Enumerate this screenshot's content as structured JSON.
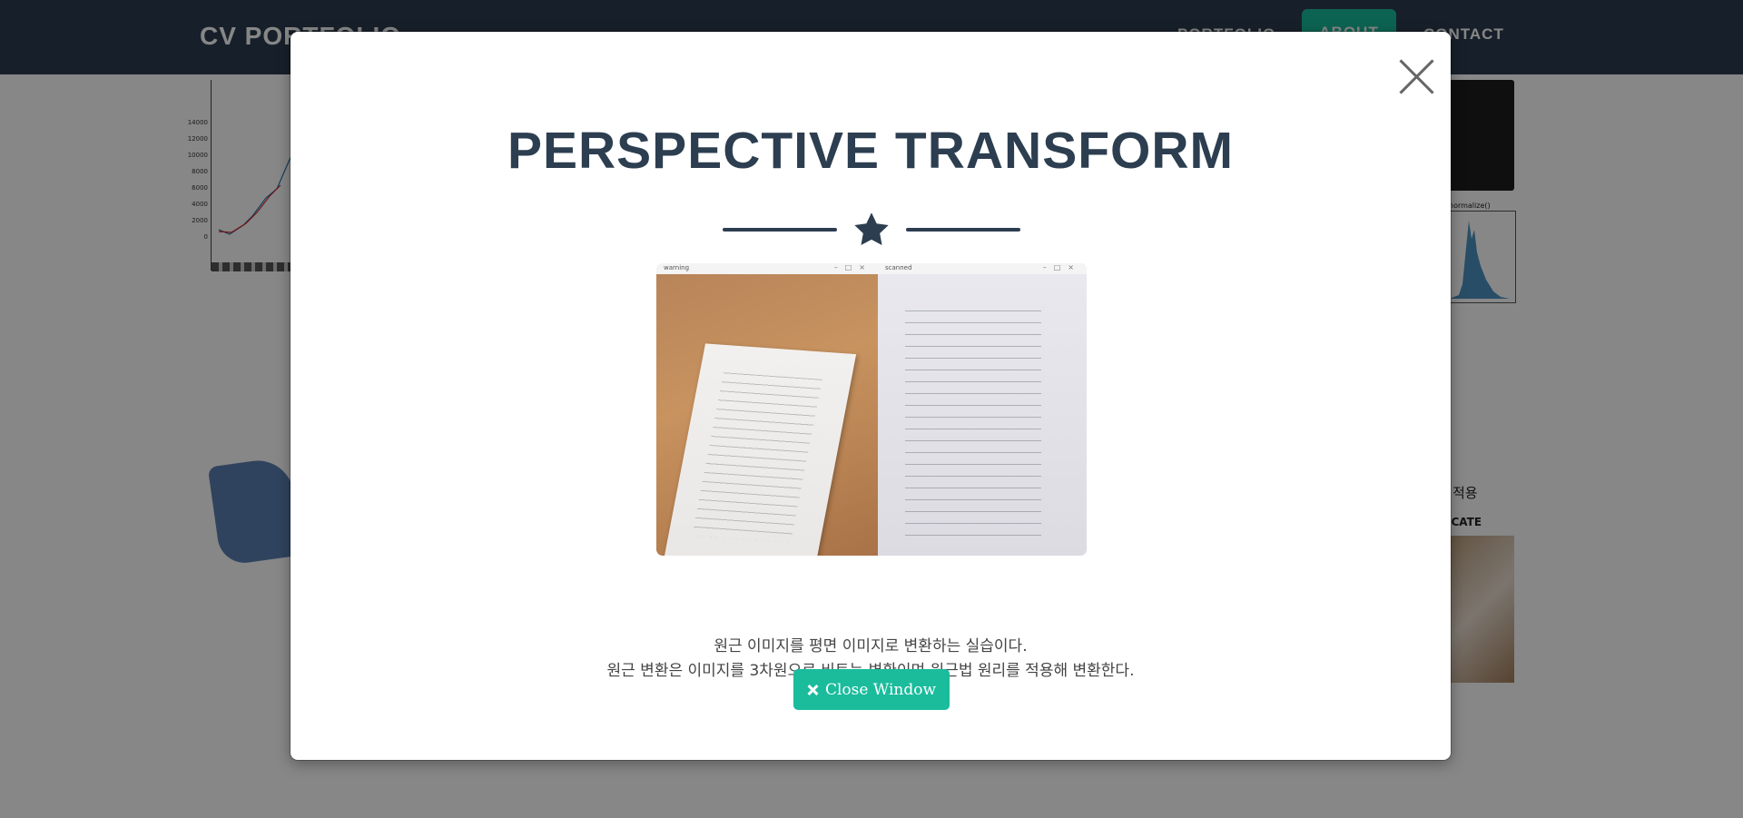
{
  "background": {
    "navbar": {
      "brand": "CV PORTFOLIO",
      "items": [
        "PORTFOLIO",
        "ABOUT",
        "CONTACT"
      ]
    },
    "chart_ticks": [
      "14000",
      "12000",
      "10000",
      "8000",
      "6000",
      "4000",
      "2000",
      "0"
    ],
    "right_panel": {
      "hist_title": "normalize()",
      "text_1": "적용",
      "text_2": "ICATE"
    }
  },
  "modal": {
    "title": "PERSPECTIVE TRANSFORM",
    "image": {
      "left_window_title": "warning",
      "right_window_title": "scanned"
    },
    "description": [
      "원근 이미지를 평면 이미지로 변환하는 실습이다.",
      "원근 변환은 이미지를 3차원으로 비트는 변환이며 원근법 원리를 적용해 변환한다."
    ],
    "close_button_label": "Close Window"
  },
  "colors": {
    "navbar": "#2c3e50",
    "accent": "#1abc9c",
    "title": "#2c3e50"
  },
  "icons": {
    "modal_close": "close-icon",
    "divider": "star-icon",
    "button": "times-icon"
  }
}
